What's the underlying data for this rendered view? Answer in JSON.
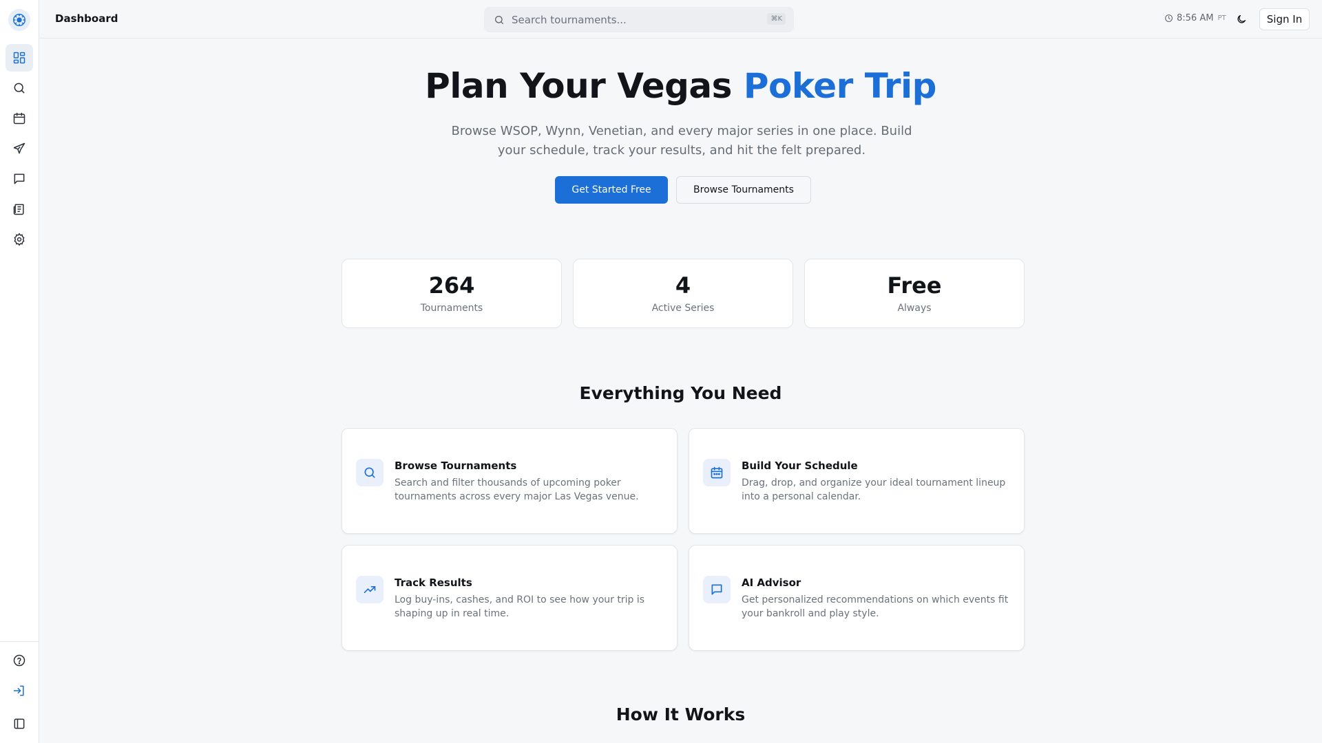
{
  "topbar": {
    "title": "Dashboard",
    "search_placeholder": "Search tournaments...",
    "search_shortcut": "⌘K",
    "time": "8:56 AM",
    "timezone": "PT",
    "signin_label": "Sign In"
  },
  "sidebar": {
    "items": [
      {
        "name": "dashboard",
        "icon": "grid-icon",
        "active": true
      },
      {
        "name": "search",
        "icon": "search-icon",
        "active": false
      },
      {
        "name": "calendar",
        "icon": "calendar-icon",
        "active": false
      },
      {
        "name": "trips",
        "icon": "plane-icon",
        "active": false
      },
      {
        "name": "chat",
        "icon": "chat-icon",
        "active": false
      },
      {
        "name": "news",
        "icon": "newspaper-icon",
        "active": false
      },
      {
        "name": "settings",
        "icon": "gear-icon",
        "active": false
      }
    ],
    "bottom_items": [
      {
        "name": "help",
        "icon": "help-icon"
      },
      {
        "name": "login",
        "icon": "login-icon"
      },
      {
        "name": "collapse",
        "icon": "sidebar-toggle-icon"
      }
    ]
  },
  "hero": {
    "title_main": "Plan Your Vegas",
    "title_accent": "Poker Trip",
    "subtitle": "Browse WSOP, Wynn, Venetian, and every major series in one place. Build your schedule, track your results, and hit the felt prepared.",
    "primary_cta": "Get Started Free",
    "secondary_cta": "Browse Tournaments"
  },
  "stats": [
    {
      "value": "264",
      "label": "Tournaments"
    },
    {
      "value": "4",
      "label": "Active Series"
    },
    {
      "value": "Free",
      "label": "Always"
    }
  ],
  "features_section": {
    "title": "Everything You Need",
    "items": [
      {
        "icon": "search-icon",
        "title": "Browse Tournaments",
        "description": "Search and filter thousands of upcoming poker tournaments across every major Las Vegas venue."
      },
      {
        "icon": "calendar-icon",
        "title": "Build Your Schedule",
        "description": "Drag, drop, and organize your ideal tournament lineup into a personal calendar."
      },
      {
        "icon": "trending-up-icon",
        "title": "Track Results",
        "description": "Log buy-ins, cashes, and ROI to see how your trip is shaping up in real time."
      },
      {
        "icon": "chat-icon",
        "title": "AI Advisor",
        "description": "Get personalized recommendations on which events fit your bankroll and play style."
      }
    ]
  },
  "how_it_works": {
    "title": "How It Works"
  },
  "colors": {
    "accent": "#1b6fd6",
    "background": "#f6f7f9",
    "card": "#ffffff",
    "text": "#111418",
    "muted": "#6b727c"
  }
}
